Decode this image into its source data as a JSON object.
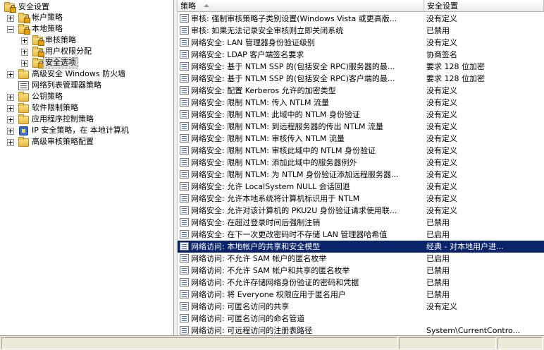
{
  "tree": {
    "root": "安全设置",
    "items": [
      {
        "label": "帐户策略"
      },
      {
        "label": "本地策略"
      },
      {
        "label": "审核策略"
      },
      {
        "label": "用户权限分配"
      },
      {
        "label": "安全选项"
      },
      {
        "label": "高级安全 Windows 防火墙"
      },
      {
        "label": "网络列表管理器策略"
      },
      {
        "label": "公钥策略"
      },
      {
        "label": "软件限制策略"
      },
      {
        "label": "应用程序控制策略"
      },
      {
        "label": "IP 安全策略，在 本地计算机"
      },
      {
        "label": "高级审核策略配置"
      }
    ]
  },
  "list": {
    "columns": {
      "policy": "策略",
      "setting": "安全设置"
    },
    "rows": [
      {
        "policy": "审核: 强制审核策略子类别设置(Windows Vista 或更高版...",
        "setting": "没有定义"
      },
      {
        "policy": "审核: 如果无法记录安全审核则立即关闭系统",
        "setting": "已禁用"
      },
      {
        "policy": "网络安全: LAN 管理器身份验证级别",
        "setting": "没有定义"
      },
      {
        "policy": "网络安全: LDAP 客户端签名要求",
        "setting": "协商签名"
      },
      {
        "policy": "网络安全: 基于 NTLM SSP 的(包括安全 RPC)服务器的最...",
        "setting": "要求 128 位加密"
      },
      {
        "policy": "网络安全: 基于 NTLM SSP 的(包括安全 RPC)客户端的最...",
        "setting": "要求 128 位加密"
      },
      {
        "policy": "网络安全: 配置 Kerberos 允许的加密类型",
        "setting": "没有定义"
      },
      {
        "policy": "网络安全: 限制 NTLM: 传入 NTLM 流量",
        "setting": "没有定义"
      },
      {
        "policy": "网络安全: 限制 NTLM: 此域中的 NTLM 身份验证",
        "setting": "没有定义"
      },
      {
        "policy": "网络安全: 限制 NTLM: 到远程服务器的传出 NTLM 流量",
        "setting": "没有定义"
      },
      {
        "policy": "网络安全: 限制 NTLM: 审核传入 NTLM 流量",
        "setting": "没有定义"
      },
      {
        "policy": "网络安全: 限制 NTLM: 审核此域中的 NTLM 身份验证",
        "setting": "没有定义"
      },
      {
        "policy": "网络安全: 限制 NTLM: 添加此域中的服务器例外",
        "setting": "没有定义"
      },
      {
        "policy": "网络安全: 限制 NTLM: 为 NTLM 身份验证添加远程服务器...",
        "setting": "没有定义"
      },
      {
        "policy": "网络安全: 允许 LocalSystem NULL 会话回退",
        "setting": "没有定义"
      },
      {
        "policy": "网络安全: 允许本地系统将计算机标识用于 NTLM",
        "setting": "没有定义"
      },
      {
        "policy": "网络安全: 允许对该计算机的 PKU2U 身份验证请求使用联...",
        "setting": "没有定义"
      },
      {
        "policy": "网络安全: 在超过登录时间后强制注销",
        "setting": "已禁用"
      },
      {
        "policy": "网络安全: 在下一次更改密码时不存储 LAN 管理器哈希值",
        "setting": "已启用"
      },
      {
        "policy": "网络访问: 本地帐户的共享和安全模型",
        "setting": "经典 - 对本地用户进..."
      },
      {
        "policy": "网络访问: 不允许 SAM 帐户的匿名枚举",
        "setting": "已启用"
      },
      {
        "policy": "网络访问: 不允许 SAM 帐户和共享的匿名枚举",
        "setting": "已禁用"
      },
      {
        "policy": "网络访问: 不允许存储网络身份验证的密码和凭据",
        "setting": "已禁用"
      },
      {
        "policy": "网络访问: 将 Everyone 权限应用于匿名用户",
        "setting": "已禁用"
      },
      {
        "policy": "网络访问: 可匿名访问的共享",
        "setting": "没有定义"
      },
      {
        "policy": "网络访问: 可匿名访问的命名管道",
        "setting": ""
      },
      {
        "policy": "网络访问: 可远程访问的注册表路径",
        "setting": "System\\CurrentContro..."
      }
    ]
  }
}
